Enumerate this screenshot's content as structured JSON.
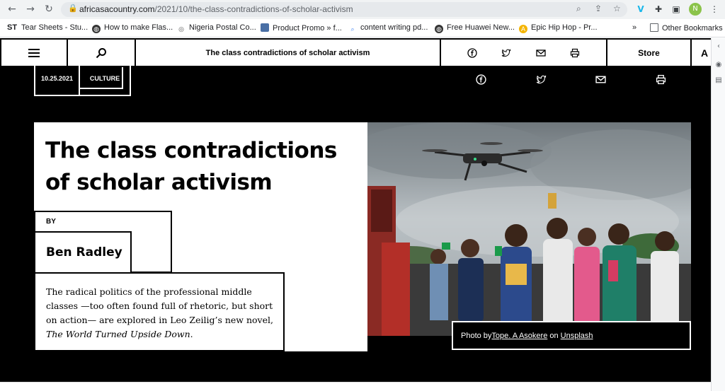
{
  "browser": {
    "url_domain": "africasacountry.com",
    "url_path": "/2021/10/the-class-contradictions-of-scholar-activism",
    "bookmarks": [
      {
        "label": "Tear Sheets - Stu...",
        "icon": "st-logo-icon"
      },
      {
        "label": "How to make Flas...",
        "icon": "globe-icon"
      },
      {
        "label": "Nigeria Postal Co...",
        "icon": "nipost-icon"
      },
      {
        "label": "Product Promo » f...",
        "icon": "promo-icon"
      },
      {
        "label": "content writing pd...",
        "icon": "search-icon"
      },
      {
        "label": "Free Huawei New...",
        "icon": "globe-icon"
      },
      {
        "label": "Epic Hip Hop - Pr...",
        "icon": "epic-icon"
      }
    ],
    "bookmarks_overflow": "»",
    "other_bookmarks": "Other Bookmarks",
    "st_label": "ST",
    "avatar_letter": "N"
  },
  "header": {
    "title": "The class contradictions of scholar activism",
    "store": "Store",
    "font_toggle": "A"
  },
  "article": {
    "date": "10.25.2021",
    "category": "CULTURE",
    "title_line1": "The class contradictions",
    "title_line2": "of scholar activism",
    "by_label": "BY",
    "author": "Ben Radley",
    "dek_main": "The radical politics of the professional middle classes —too often found full of rhetoric, but short on action— are explored in Leo Zeilig’s new novel, ",
    "dek_book": "The World Turned Upside Down",
    "dek_end": ".",
    "caption_prefix": "Photo by ",
    "caption_author": "Tope. A Asokere",
    "caption_mid": " on ",
    "caption_source": "Unsplash"
  },
  "colors": {
    "hero_bg": "#000000",
    "panel_bg": "#ffffff",
    "text": "#000000"
  }
}
